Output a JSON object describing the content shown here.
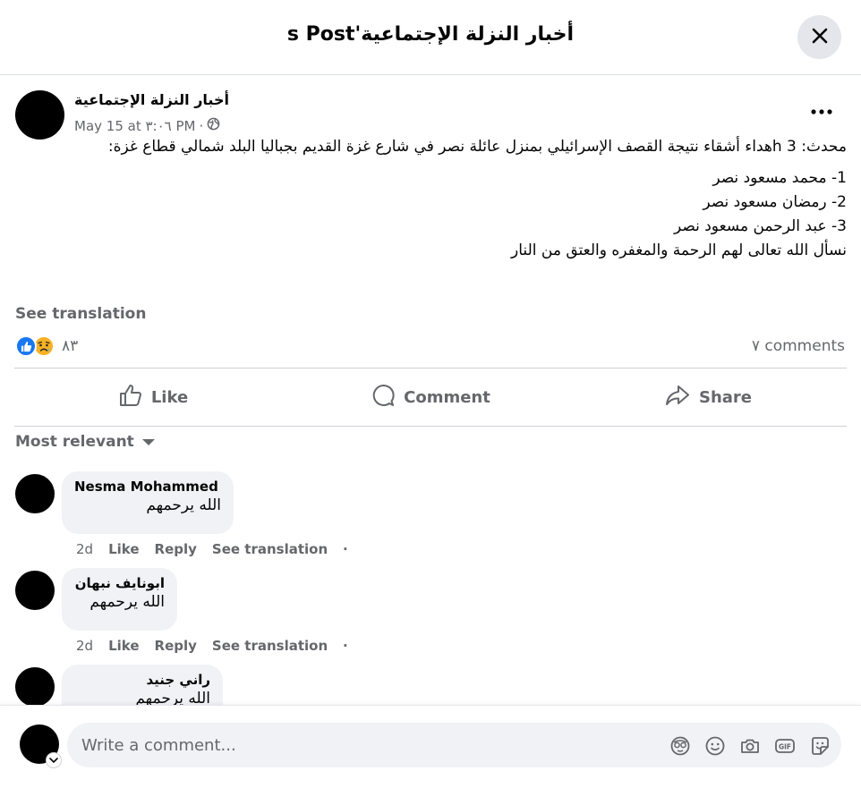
{
  "header": {
    "title": "أخبار النزلة الإجتماعية's Post"
  },
  "post": {
    "author": "أخبار النزلة الإجتماعية",
    "date": "May 15 at ٣:٠٦ PM",
    "separator": "·",
    "body": [
      "محدث: 3 hهداء أشقاء نتيجة القصف الإسرائيلي بمنزل عائلة نصر في شارع غزة القديم بجباليا البلد شمالي قطاع غزة:",
      "1- محمد مسعود نصر",
      "2- رمضان مسعود نصر",
      "3- عبد الرحمن مسعود نصر",
      "نسأل الله تعالى لهم الرحمة والمغفره والعتق من النار"
    ],
    "see_translation": "See translation",
    "reactions_count": "٨٣",
    "comments_count": "٧ comments"
  },
  "actions": {
    "like": "Like",
    "comment": "Comment",
    "share": "Share"
  },
  "sort": {
    "label": "Most relevant"
  },
  "comments": [
    {
      "name": "Nesma Mohammed",
      "text": "الله يرحمهم",
      "time": "2d",
      "like": "Like",
      "reply": "Reply",
      "translate": "See translation"
    },
    {
      "name": "ابونايف نبهان",
      "text": "الله يرحمهم",
      "time": "2d",
      "like": "Like",
      "reply": "Reply",
      "translate": "See translation"
    },
    {
      "name": "راني جنيد",
      "text": "الله يرحمهم"
    }
  ],
  "composer": {
    "placeholder": "Write a comment..."
  },
  "colors": {
    "accent": "#1877f2",
    "muted": "#65676b",
    "bubble": "#f0f2f5"
  }
}
